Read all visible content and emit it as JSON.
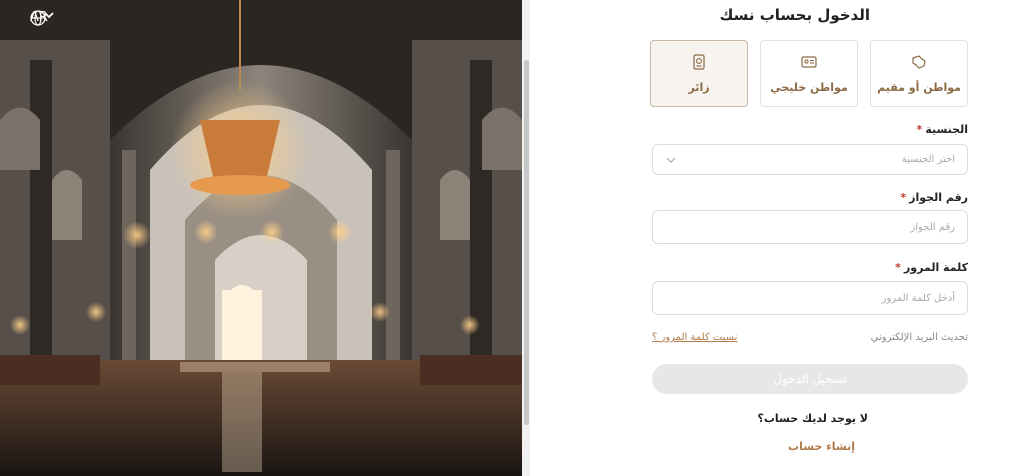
{
  "language": {
    "label": "AR"
  },
  "form": {
    "title": "الدخول بحساب نسك",
    "account_types": [
      {
        "label": "مواطن أو مقيم",
        "icon": "saudi-map-icon"
      },
      {
        "label": "مواطن خليجي",
        "icon": "id-card-icon"
      },
      {
        "label": "زائر",
        "icon": "passport-icon",
        "selected": true
      }
    ],
    "nationality": {
      "label": "الجنسية",
      "required_mark": "*",
      "placeholder": "اختر الجنسية"
    },
    "passport": {
      "label": "رقم الجواز",
      "required_mark": "*",
      "placeholder": "رقم الجواز"
    },
    "password": {
      "label": "كلمة المرور",
      "required_mark": "*",
      "placeholder": "أدخل كلمة المرور"
    },
    "update_email_link": "تحديث البريد الإلكتروني",
    "forgot_password_link": "نسيت كلمة المرور ؟",
    "submit_label": "تسجيل الدخول",
    "no_account_text": "لا يوجد لديك حساب؟",
    "create_account_link": "إنشاء حساب"
  },
  "colors": {
    "accent": "#b07a48",
    "selected_card_bg": "#f7f3ee",
    "disabled_button": "#e7e7e7",
    "required": "#c0392b"
  }
}
